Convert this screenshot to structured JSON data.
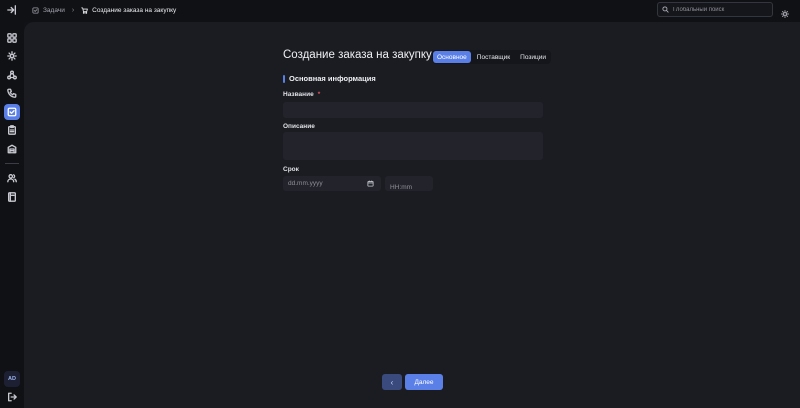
{
  "breadcrumb": {
    "items": [
      "Задачи",
      "Создание заказа на закупку"
    ]
  },
  "search": {
    "placeholder": "Глобальный поиск"
  },
  "sidebar": {
    "user_initials": "AD",
    "icons": [
      "collapse-menu-icon",
      "dashboard-icon",
      "settings-cog-icon",
      "network-icon",
      "phone-icon",
      "tasks-icon",
      "clipboard-icon",
      "storage-icon",
      "users-icon",
      "book-icon",
      "logout-icon"
    ]
  },
  "page": {
    "title": "Создание заказа на закупку",
    "tabs": [
      {
        "label": "Основное",
        "active": true
      },
      {
        "label": "Поставщик",
        "active": false
      },
      {
        "label": "Позиции",
        "active": false
      }
    ],
    "section_title": "Основная информация"
  },
  "form": {
    "name_label": "Название",
    "name_required": "*",
    "name_value": "",
    "description_label": "Описание",
    "description_value": "",
    "due_label": "Срок",
    "date_placeholder": "dd.mm.yyyy",
    "time_placeholder": "HH:mm"
  },
  "actions": {
    "back_symbol": "‹",
    "next_label": "Далее"
  },
  "colors": {
    "accent": "#5a80e8",
    "background": "#111217",
    "panel": "#1b1c22",
    "required": "#e0565d"
  }
}
